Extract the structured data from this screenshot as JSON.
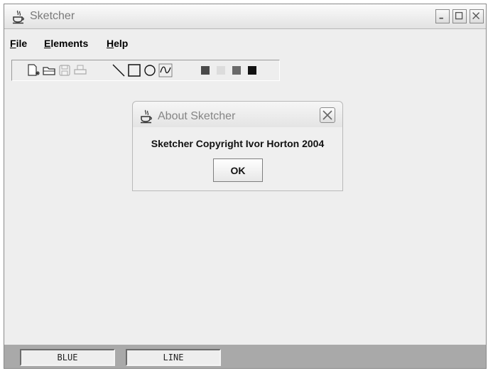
{
  "window": {
    "title": "Sketcher",
    "controls": [
      "minimize-icon",
      "maximize-icon",
      "close-icon"
    ]
  },
  "menu": {
    "items": [
      {
        "mnemonic": "F",
        "rest": "ile"
      },
      {
        "mnemonic": "E",
        "rest": "lements"
      },
      {
        "mnemonic": "H",
        "rest": "elp"
      }
    ]
  },
  "toolbar": {
    "buttons": [
      {
        "icon": "new-file-icon",
        "enabled": true
      },
      {
        "icon": "open-file-icon",
        "enabled": true
      },
      {
        "icon": "save-icon",
        "enabled": false
      },
      {
        "icon": "print-icon",
        "enabled": false
      },
      {
        "icon": "line-tool-icon",
        "enabled": true
      },
      {
        "icon": "rectangle-tool-icon",
        "enabled": true
      },
      {
        "icon": "circle-tool-icon",
        "enabled": true
      },
      {
        "icon": "curve-tool-icon",
        "enabled": true
      },
      {
        "icon": "color-swatch-icon",
        "color": "#4a4a4a"
      },
      {
        "icon": "color-swatch-icon",
        "color": "#dcdcdc"
      },
      {
        "icon": "color-swatch-icon",
        "color": "#6a6a6a"
      },
      {
        "icon": "color-swatch-icon",
        "color": "#111111"
      }
    ]
  },
  "dialog": {
    "title": "About Sketcher",
    "message": "Sketcher Copyright Ivor Horton 2004",
    "ok_label": "OK"
  },
  "status": {
    "color": "BLUE",
    "element_type": "LINE"
  }
}
